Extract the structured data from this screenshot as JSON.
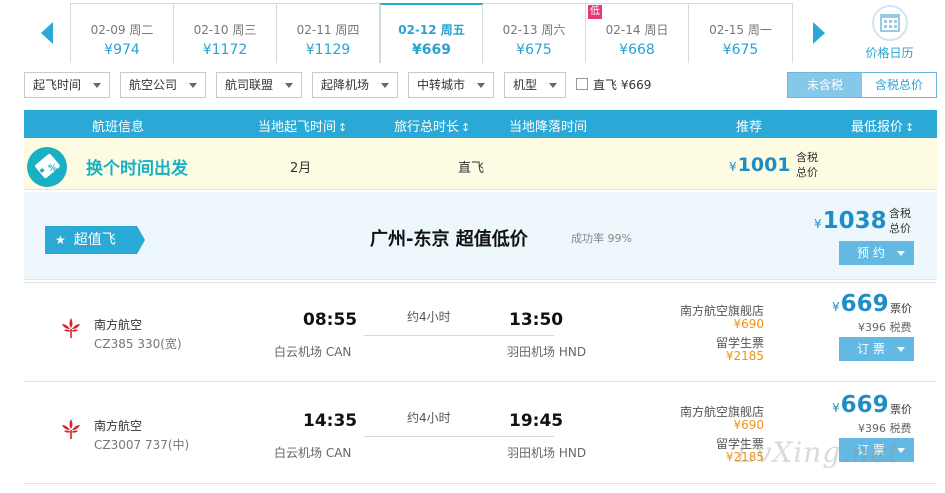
{
  "date_strip": {
    "dates": [
      {
        "date": "02-09 周二",
        "price": "¥974",
        "low": false,
        "active": false
      },
      {
        "date": "02-10 周三",
        "price": "¥1172",
        "low": false,
        "active": false
      },
      {
        "date": "02-11 周四",
        "price": "¥1129",
        "low": false,
        "active": false
      },
      {
        "date": "02-12 周五",
        "price": "¥669",
        "low": false,
        "active": true
      },
      {
        "date": "02-13 周六",
        "price": "¥675",
        "low": false,
        "active": false
      },
      {
        "date": "02-14 周日",
        "price": "¥668",
        "low": true,
        "active": false
      },
      {
        "date": "02-15 周一",
        "price": "¥675",
        "low": false,
        "active": false
      }
    ],
    "low_badge": "低",
    "calendar_label": "价格日历"
  },
  "filters": {
    "takeoff_time": "起飞时间",
    "airline": "航空公司",
    "alliance": "航司联盟",
    "airport": "起降机场",
    "transfer_city": "中转城市",
    "aircraft": "机型",
    "direct_label": "直飞 ¥669",
    "tax_excl": "未含税",
    "tax_incl": "含税总价"
  },
  "header": {
    "flight_info": "航班信息",
    "depart_time": "当地起飞时间",
    "duration": "旅行总时长",
    "arrive_time": "当地降落时间",
    "recommend": "推荐",
    "lowest_price": "最低报价",
    "sort_glyph": "↕"
  },
  "promo": {
    "title": "换个时间出发",
    "month": "2月",
    "direct": "直飞",
    "yen": "¥",
    "price": "1001",
    "tax_note": "含税总价"
  },
  "deal": {
    "badge": "超值飞",
    "title": "广州-东京 超值低价",
    "success_rate": "成功率 99%",
    "yen": "¥",
    "price": "1038",
    "tax_note": "含税总价",
    "book_label": "预 约"
  },
  "flights": [
    {
      "airline": "南方航空",
      "flight_no": "CZ385 330(宽)",
      "dep_time": "08:55",
      "dep_airport": "白云机场 CAN",
      "duration": "约4小时",
      "arr_time": "13:50",
      "arr_airport": "羽田机场 HND",
      "shop1": "南方航空旗舰店",
      "shop1_price": "¥690",
      "shop2": "留学生票",
      "shop2_price": "¥2185",
      "yen": "¥",
      "price": "669",
      "price_label": "票价",
      "tax": "¥396 税费",
      "book_label": "订 票"
    },
    {
      "airline": "南方航空",
      "flight_no": "CZ3007 737(中)",
      "dep_time": "14:35",
      "dep_airport": "白云机场 CAN",
      "duration": "约4小时",
      "arr_time": "19:45",
      "arr_airport": "羽田机场 HND",
      "shop1": "南方航空旗舰店",
      "shop1_price": "¥690",
      "shop2": "留学生票",
      "shop2_price": "¥2185",
      "yen": "¥",
      "price": "669",
      "price_label": "票价",
      "tax": "¥396 税费",
      "book_label": "订 票"
    }
  ],
  "watermark": "LvXing.net",
  "colors": {
    "accent": "#2ba9d6",
    "price_blue": "#1f8ec8",
    "price_orange": "#f0921b",
    "low_badge": "#e4397c",
    "promo_bg": "#fdfce3"
  }
}
